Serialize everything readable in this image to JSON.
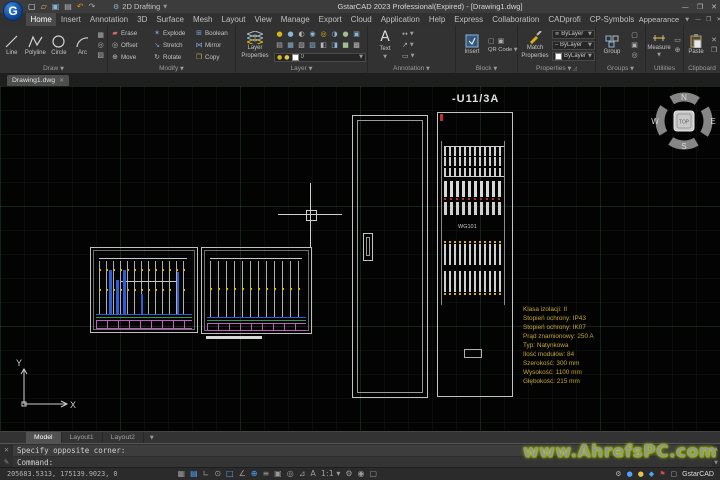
{
  "titlebar": {
    "title": "GstarCAD 2023 Professional(Expired) - [Drawing1.dwg]",
    "qat": [
      {
        "name": "new-file-icon",
        "glyph": "▢",
        "color": "#e0e0e0"
      },
      {
        "name": "open-folder-icon",
        "glyph": "▱",
        "color": "#d8b55a"
      },
      {
        "name": "save-icon",
        "glyph": "▣",
        "color": "#8ab4d8"
      },
      {
        "name": "print-icon",
        "glyph": "▤",
        "color": "#b0b0b0"
      },
      {
        "name": "undo-icon",
        "glyph": "↶",
        "color": "#e69500"
      },
      {
        "name": "redo-icon",
        "glyph": "↷",
        "color": "#a8a8a8"
      }
    ],
    "workspace_label": "2D Drafting",
    "controls": [
      {
        "name": "minimize-button",
        "glyph": "—"
      },
      {
        "name": "restore-button",
        "glyph": "❐"
      },
      {
        "name": "close-button",
        "glyph": "✕"
      }
    ]
  },
  "menubar": {
    "tabs": [
      {
        "name": "tab-home",
        "label": "Home",
        "active": true
      },
      {
        "name": "tab-insert",
        "label": "Insert"
      },
      {
        "name": "tab-annotation",
        "label": "Annotation"
      },
      {
        "name": "tab-3d",
        "label": "3D"
      },
      {
        "name": "tab-surface",
        "label": "Surface"
      },
      {
        "name": "tab-mesh",
        "label": "Mesh"
      },
      {
        "name": "tab-layout",
        "label": "Layout"
      },
      {
        "name": "tab-view",
        "label": "View"
      },
      {
        "name": "tab-manage",
        "label": "Manage"
      },
      {
        "name": "tab-export",
        "label": "Export"
      },
      {
        "name": "tab-cloud",
        "label": "Cloud"
      },
      {
        "name": "tab-application",
        "label": "Application"
      },
      {
        "name": "tab-help",
        "label": "Help"
      },
      {
        "name": "tab-express",
        "label": "Express"
      },
      {
        "name": "tab-collaboration",
        "label": "Collaboration"
      },
      {
        "name": "tab-cadprofi",
        "label": "CADprofi"
      },
      {
        "name": "tab-cp-symbols",
        "label": "CP-Symbols"
      }
    ],
    "appearance": "Appearance",
    "doc_controls": [
      {
        "name": "doc-minimize-button",
        "glyph": "—"
      },
      {
        "name": "doc-restore-button",
        "glyph": "❐"
      },
      {
        "name": "doc-close-button",
        "glyph": "✕"
      }
    ]
  },
  "ribbon": {
    "draw": {
      "label": "Draw",
      "tools": [
        "Line",
        "Polyline",
        "Circle",
        "Arc"
      ],
      "minis": [
        {
          "name": "array-tool",
          "glyph": "▦"
        },
        {
          "name": "revision-cloud-tool",
          "glyph": "◎"
        },
        {
          "name": "hatch-tool",
          "glyph": "▨"
        }
      ]
    },
    "modify": {
      "label": "Modify",
      "tools": [
        {
          "name": "erase-tool",
          "label": "Erase",
          "glyph": "▰",
          "color": "#d06a6a"
        },
        {
          "name": "explode-tool",
          "label": "Explode",
          "glyph": "✶",
          "color": "#7aa0d0"
        },
        {
          "name": "boolean-tool",
          "label": "Boolean",
          "glyph": "⊞",
          "color": "#7aa0d0"
        },
        {
          "name": "offset-tool",
          "label": "Offset",
          "glyph": "◎",
          "color": "#b8b8b8"
        },
        {
          "name": "stretch-tool",
          "label": "Stretch",
          "glyph": "↘",
          "color": "#7aa0d0"
        },
        {
          "name": "mirror-tool",
          "label": "Mirror",
          "glyph": "⋈",
          "color": "#7aa0d0"
        },
        {
          "name": "move-tool",
          "label": "Move",
          "glyph": "⊕",
          "color": "#b8b8b8"
        },
        {
          "name": "rotate-tool",
          "label": "Rotate",
          "glyph": "↻",
          "color": "#b8b8b8"
        },
        {
          "name": "copy-tool",
          "label": "Copy",
          "glyph": "❐",
          "color": "#c8a850"
        }
      ]
    },
    "layer": {
      "label": "Layer",
      "big_line1": "Layer",
      "big_line2": "Properties",
      "current": "0",
      "minis": [
        {
          "name": "layer-on-icon",
          "glyph": "●",
          "color": "#d9b417"
        },
        {
          "name": "layer-freeze-icon",
          "glyph": "●",
          "color": "#8ab4d8"
        },
        {
          "name": "layer-lock-icon",
          "glyph": "◐",
          "color": "#b8b8b8"
        },
        {
          "name": "layer-isolate-icon",
          "glyph": "◉",
          "color": "#8ab4d8"
        },
        {
          "name": "layer-off-icon",
          "glyph": "◎",
          "color": "#d9b417"
        },
        {
          "name": "layer-thaw-icon",
          "glyph": "◑",
          "color": "#8ab4d8"
        },
        {
          "name": "layer-unlock-icon",
          "glyph": "●",
          "color": "#9fbf8f"
        },
        {
          "name": "layer-match-icon",
          "glyph": "▣",
          "color": "#8ab4d8"
        },
        {
          "name": "layer-prev-icon",
          "glyph": "▤",
          "color": "#b8b8b8"
        },
        {
          "name": "layer-walk-icon",
          "glyph": "▦",
          "color": "#8ab4d8"
        },
        {
          "name": "layer-merge-icon",
          "glyph": "▧",
          "color": "#b8b8b8"
        },
        {
          "name": "layer-delete-icon",
          "glyph": "▨",
          "color": "#8ab4d8"
        },
        {
          "name": "layer-copy-icon",
          "glyph": "◧",
          "color": "#b8b8b8"
        },
        {
          "name": "layer-vpfreeze-icon",
          "glyph": "◨",
          "color": "#8ab4d8"
        },
        {
          "name": "layer-states-icon",
          "glyph": "■",
          "color": "#9fbf8f"
        },
        {
          "name": "layer-new-icon",
          "glyph": "▩",
          "color": "#b8b8b8"
        }
      ]
    },
    "annotation": {
      "label": "Annotation",
      "big": "Text",
      "minis": [
        {
          "name": "linear-dimension-tool",
          "glyph": "↔"
        },
        {
          "name": "leader-tool",
          "glyph": "↗"
        },
        {
          "name": "table-tool",
          "glyph": "▭"
        }
      ]
    },
    "block": {
      "label": "Block",
      "big": "Insert",
      "qr_label": "QR Code",
      "minis": [
        {
          "name": "create-block-tool",
          "glyph": "▢"
        },
        {
          "name": "edit-block-tool",
          "glyph": "▣"
        }
      ]
    },
    "properties": {
      "label": "Properties",
      "big_line1": "Match",
      "big_line2": "Properties",
      "values": [
        "ByLayer",
        "ByLayer",
        "ByLayer"
      ]
    },
    "groups": {
      "label": "Groups",
      "big": "Group",
      "minis": [
        {
          "name": "ungroup-tool",
          "glyph": "▢"
        },
        {
          "name": "group-edit-tool",
          "glyph": "▣"
        },
        {
          "name": "group-select-tool",
          "glyph": "◎"
        }
      ]
    },
    "utilities": {
      "label": "Utilities",
      "big": "Measure",
      "minis": [
        {
          "name": "quick-select-tool",
          "glyph": "▭"
        },
        {
          "name": "point-style-tool",
          "glyph": "⊕"
        }
      ]
    },
    "clipboard": {
      "label": "Clipboard",
      "big": "Paste",
      "minis": [
        {
          "name": "cut-tool",
          "glyph": "✕"
        },
        {
          "name": "copy-clip-tool",
          "glyph": "❐"
        }
      ]
    }
  },
  "docbar": {
    "tabs": [
      {
        "name": "doc-tab-drawing1",
        "label": "Drawing1.dwg",
        "active": true
      }
    ]
  },
  "canvas": {
    "cabinet_label": "-U11/3A",
    "component_label": "WG101",
    "spec_lines": [
      "Klasa izolacji: II",
      "Stopień ochrony: IP43",
      "Stopień ochrony: IK07",
      "Prąd znamionowy: 250 A",
      "Typ: Natynkowa",
      "Ilość modułów: 84",
      "Szerokość: 300 mm",
      "Wysokość: 1100 mm",
      "Głębokość: 215 mm"
    ],
    "compass": {
      "n": "N",
      "e": "E",
      "s": "S",
      "w": "W",
      "top": "TOP"
    },
    "ucs": {
      "x": "X",
      "y": "Y"
    }
  },
  "layoutbar": {
    "tabs": [
      {
        "name": "model-tab",
        "label": "Model",
        "active": true
      },
      {
        "name": "layout1-tab",
        "label": "Layout1"
      },
      {
        "name": "layout2-tab",
        "label": "Layout2"
      }
    ]
  },
  "command": {
    "line1": "Specify opposite corner:",
    "line2": "Command:"
  },
  "statusbar": {
    "coords": "205683.5313, 175139.9023, 0",
    "toggles": [
      {
        "name": "snap-toggle",
        "glyph": "▦"
      },
      {
        "name": "grid-toggle",
        "glyph": "▤",
        "color": "#4da6ff"
      },
      {
        "name": "ortho-toggle",
        "glyph": "∟"
      },
      {
        "name": "polar-toggle",
        "glyph": "⊙"
      },
      {
        "name": "osnap-toggle",
        "glyph": "□",
        "color": "#4da6ff"
      },
      {
        "name": "otrack-toggle",
        "glyph": "∠"
      },
      {
        "name": "dyn-input-toggle",
        "glyph": "⊕",
        "color": "#4da6ff"
      },
      {
        "name": "lineweight-toggle",
        "glyph": "≡"
      },
      {
        "name": "transparency-toggle",
        "glyph": "▣"
      },
      {
        "name": "cycling-toggle",
        "glyph": "◎"
      },
      {
        "name": "dynamic-ucs-toggle",
        "glyph": "⊿"
      },
      {
        "name": "annotation-visibility-toggle",
        "glyph": "A"
      },
      {
        "name": "annotation-scale-control",
        "glyph": "1:1 ▾"
      },
      {
        "name": "workspace-gear-icon",
        "glyph": "⚙"
      },
      {
        "name": "isolate-objects-toggle",
        "glyph": "◉"
      },
      {
        "name": "clean-screen-toggle",
        "glyph": "▢"
      }
    ],
    "right_icons": [
      {
        "name": "performance-icon",
        "glyph": "⚙",
        "color": "#b0b0b0"
      },
      {
        "name": "cloud-status-icon",
        "glyph": "●",
        "color": "#4da6ff"
      },
      {
        "name": "hint-bulb-icon",
        "glyph": "●",
        "color": "#e6c34a"
      },
      {
        "name": "network-status-icon",
        "glyph": "◆",
        "color": "#4da6ff"
      },
      {
        "name": "notification-flag-icon",
        "glyph": "⚑",
        "color": "#d04a4a"
      },
      {
        "name": "expand-icon",
        "glyph": "▢",
        "color": "#b0b0b0"
      }
    ],
    "brand": "GstarCAD"
  },
  "watermark": "www.AhrefsPC.com",
  "colors": {
    "accent_blue": "#2b5fd9",
    "symbol_yellow": "#d9b417",
    "magenta": "#c060c0",
    "green": "#2e9e4f",
    "spec_yellow": "#c8a832",
    "watermark_glow": "#a6d808"
  }
}
